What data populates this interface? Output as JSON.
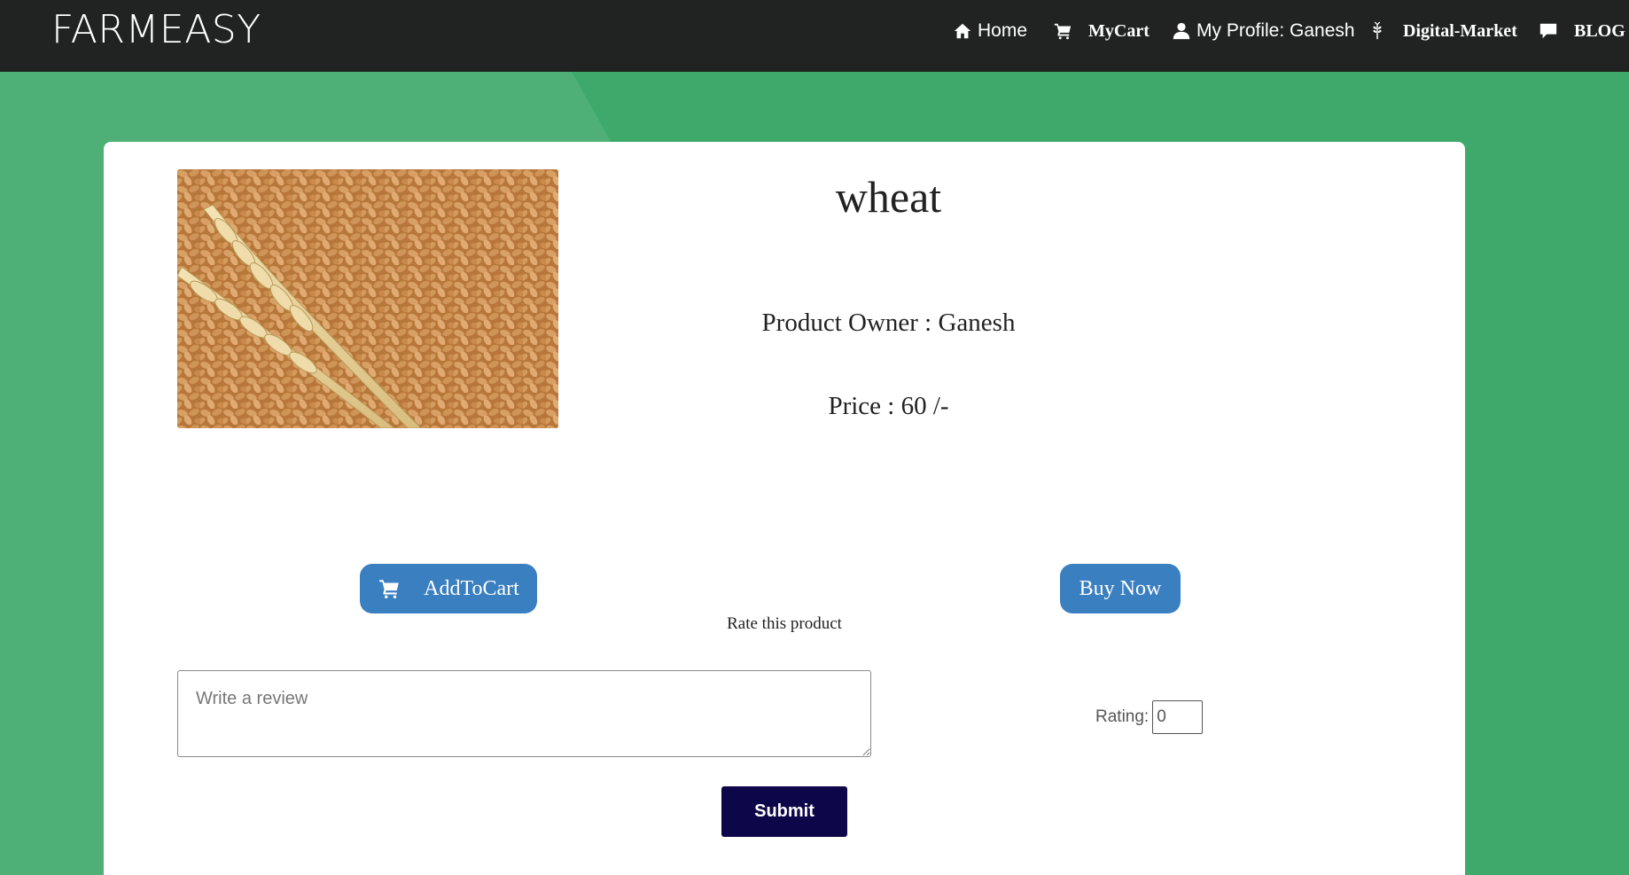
{
  "navbar": {
    "brand": "FARMEASY",
    "items": [
      {
        "label": "Home",
        "icon": "home-icon"
      },
      {
        "label": "MyCart",
        "icon": "cart-icon"
      },
      {
        "label": "My Profile: Ganesh",
        "icon": "user-icon"
      },
      {
        "label": "Digital-Market",
        "icon": "grain-icon"
      },
      {
        "label": "BLOG",
        "icon": "comment-icon"
      }
    ]
  },
  "product": {
    "name": "wheat",
    "owner_text": "Product Owner : Ganesh",
    "price_text": "Price : 60 /-",
    "image_icon": "wheat-image"
  },
  "actions": {
    "add_to_cart": "AddToCart",
    "buy_now": "Buy Now"
  },
  "review": {
    "rate_label": "Rate this product",
    "placeholder": "Write a review",
    "rating_label": "Rating:",
    "rating_value": "0",
    "submit": "Submit"
  },
  "colors": {
    "navbar_bg": "#212323",
    "page_bg": "#3ea96b",
    "button_blue": "#3a7fc0",
    "submit_bg": "#0d0649"
  }
}
